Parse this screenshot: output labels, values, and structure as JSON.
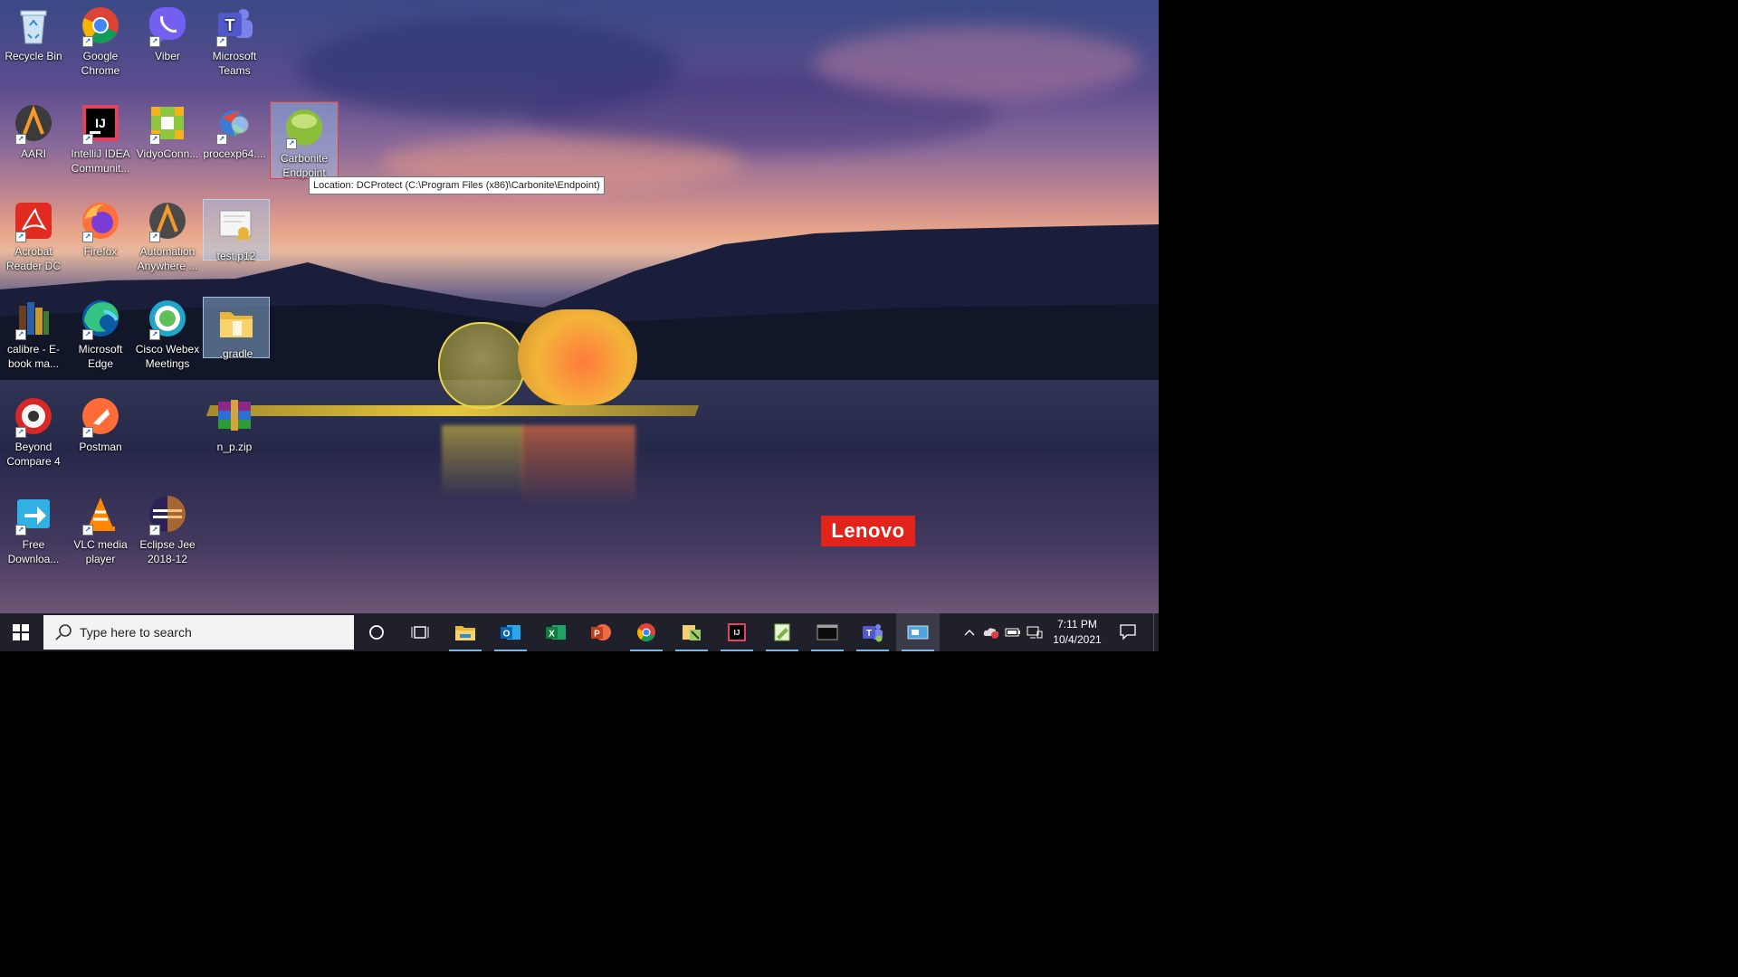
{
  "desktop": {
    "icons": [
      {
        "label": "Recycle Bin",
        "icon": "recycle-bin-icon"
      },
      {
        "label": "Google Chrome",
        "icon": "chrome-icon"
      },
      {
        "label": "Viber",
        "icon": "viber-icon"
      },
      {
        "label": "Microsoft Teams",
        "icon": "teams-icon"
      },
      {
        "label": "AARI",
        "icon": "aari-icon"
      },
      {
        "label": "IntelliJ IDEA Communit...",
        "icon": "intellij-icon"
      },
      {
        "label": "VidyoConn...",
        "icon": "vidyo-icon"
      },
      {
        "label": "procexp64....",
        "icon": "procexp-icon"
      },
      {
        "label": "Carbonite Endpoint",
        "icon": "carbonite-icon"
      },
      {
        "label": "Acrobat Reader DC",
        "icon": "acrobat-icon"
      },
      {
        "label": "Firefox",
        "icon": "firefox-icon"
      },
      {
        "label": "Automation Anywhere ...",
        "icon": "automation-anywhere-icon"
      },
      {
        "label": "test.p12",
        "icon": "certificate-icon"
      },
      {
        "label": "calibre - E-book ma...",
        "icon": "calibre-icon"
      },
      {
        "label": "Microsoft Edge",
        "icon": "edge-icon"
      },
      {
        "label": "Cisco Webex Meetings",
        "icon": "webex-icon"
      },
      {
        "label": ".gradle",
        "icon": "folder-icon"
      },
      {
        "label": "Beyond Compare 4",
        "icon": "beyond-compare-icon"
      },
      {
        "label": "Postman",
        "icon": "postman-icon"
      },
      {
        "label": "n_p.zip",
        "icon": "winrar-archive-icon"
      },
      {
        "label": "Free Downloa...",
        "icon": "free-download-icon"
      },
      {
        "label": "VLC media player",
        "icon": "vlc-icon"
      },
      {
        "label": "Eclipse Jee 2018-12",
        "icon": "eclipse-icon"
      }
    ],
    "tooltip": "Location: DCProtect (C:\\Program Files (x86)\\Carbonite\\Endpoint)",
    "brand_logo": "Lenovo"
  },
  "taskbar": {
    "search_placeholder": "Type here to search",
    "pinned": [
      {
        "icon": "cortana-icon"
      },
      {
        "icon": "task-view-icon"
      },
      {
        "icon": "file-explorer-icon"
      },
      {
        "icon": "outlook-icon"
      },
      {
        "icon": "excel-icon"
      },
      {
        "icon": "powerpoint-icon"
      },
      {
        "icon": "chrome-icon"
      },
      {
        "icon": "app-tool-icon"
      },
      {
        "icon": "intellij-icon"
      },
      {
        "icon": "notepad-plus-icon"
      },
      {
        "icon": "terminal-icon"
      },
      {
        "icon": "teams-icon"
      },
      {
        "icon": "remote-desktop-icon"
      }
    ],
    "clock_time": "7:11 PM",
    "clock_date": "10/4/2021"
  },
  "colors": {
    "taskbar_bg": "#20202a",
    "accent": "#76b9ed",
    "lenovo_red": "#e2231a"
  }
}
